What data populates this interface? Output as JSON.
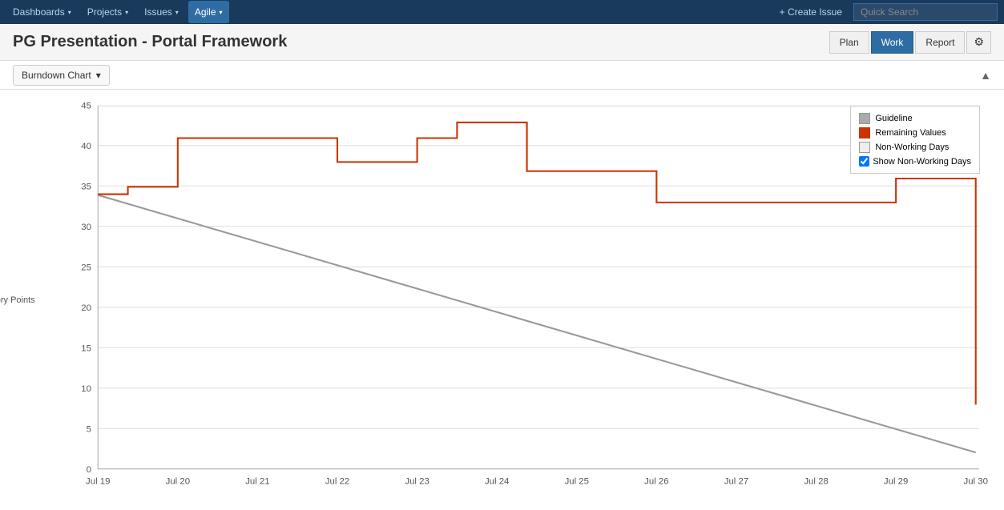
{
  "nav": {
    "items": [
      {
        "label": "Dashboards",
        "active": false,
        "hasDropdown": true
      },
      {
        "label": "Projects",
        "active": false,
        "hasDropdown": true
      },
      {
        "label": "Issues",
        "active": false,
        "hasDropdown": true
      },
      {
        "label": "Agile",
        "active": true,
        "hasDropdown": true
      }
    ],
    "createIssueLabel": "+ Create Issue",
    "searchPlaceholder": "Quick Search"
  },
  "header": {
    "title": "PG Presentation - Portal Framework",
    "buttons": [
      {
        "label": "Plan",
        "active": false
      },
      {
        "label": "Work",
        "active": true
      },
      {
        "label": "Report",
        "active": false
      }
    ],
    "gearLabel": "⚙"
  },
  "toolbar": {
    "dropdownLabel": "Burndown Chart",
    "collapseLabel": "▲"
  },
  "chart": {
    "yAxisLabel": "Story Points",
    "yMax": 45,
    "yTicks": [
      0,
      5,
      10,
      15,
      20,
      25,
      30,
      35,
      40,
      45
    ],
    "xLabels": [
      "Jul 19",
      "Jul 20",
      "Jul 21",
      "Jul 22",
      "Jul 23",
      "Jul 24",
      "Jul 25",
      "Jul 26",
      "Jul 27",
      "Jul 28",
      "Jul 29",
      "Jul 30"
    ],
    "legend": {
      "items": [
        {
          "label": "Guideline",
          "type": "guideline"
        },
        {
          "label": "Remaining Values",
          "type": "remaining"
        },
        {
          "label": "Non-Working Days",
          "type": "nonworking"
        }
      ],
      "checkboxLabel": "Show Non-Working Days",
      "checkboxChecked": true
    }
  }
}
